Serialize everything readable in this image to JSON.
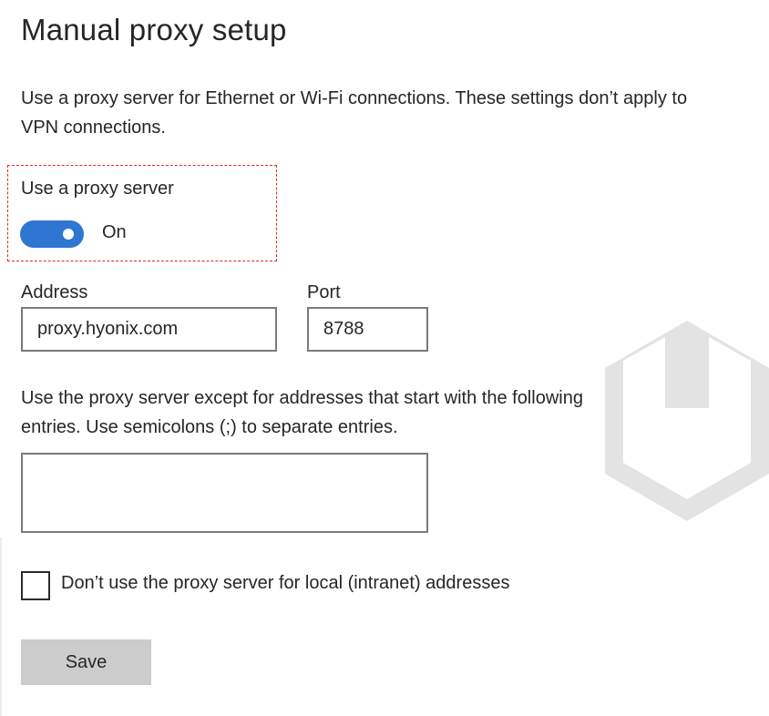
{
  "page": {
    "title": "Manual proxy setup",
    "description": "Use a proxy server for Ethernet or Wi-Fi connections. These settings don’t apply to VPN connections."
  },
  "proxy_toggle": {
    "label": "Use a proxy server",
    "state_text": "On",
    "enabled": true
  },
  "address": {
    "label": "Address",
    "value": "proxy.hyonix.com"
  },
  "port": {
    "label": "Port",
    "value": "8788"
  },
  "exceptions": {
    "description": "Use the proxy server except for addresses that start with the following entries. Use semicolons (;) to separate entries.",
    "value": ""
  },
  "local_bypass": {
    "label": "Don’t use the proxy server for local (intranet) addresses",
    "checked": false
  },
  "save": {
    "label": "Save"
  },
  "watermark": {
    "icon": "hyonix-logo-icon",
    "color": "#e3e3e3"
  },
  "colors": {
    "accent": "#2f76d2",
    "highlight_border": "#d62c2c",
    "button_bg": "#cccccc",
    "input_border": "#7a7a7a"
  }
}
